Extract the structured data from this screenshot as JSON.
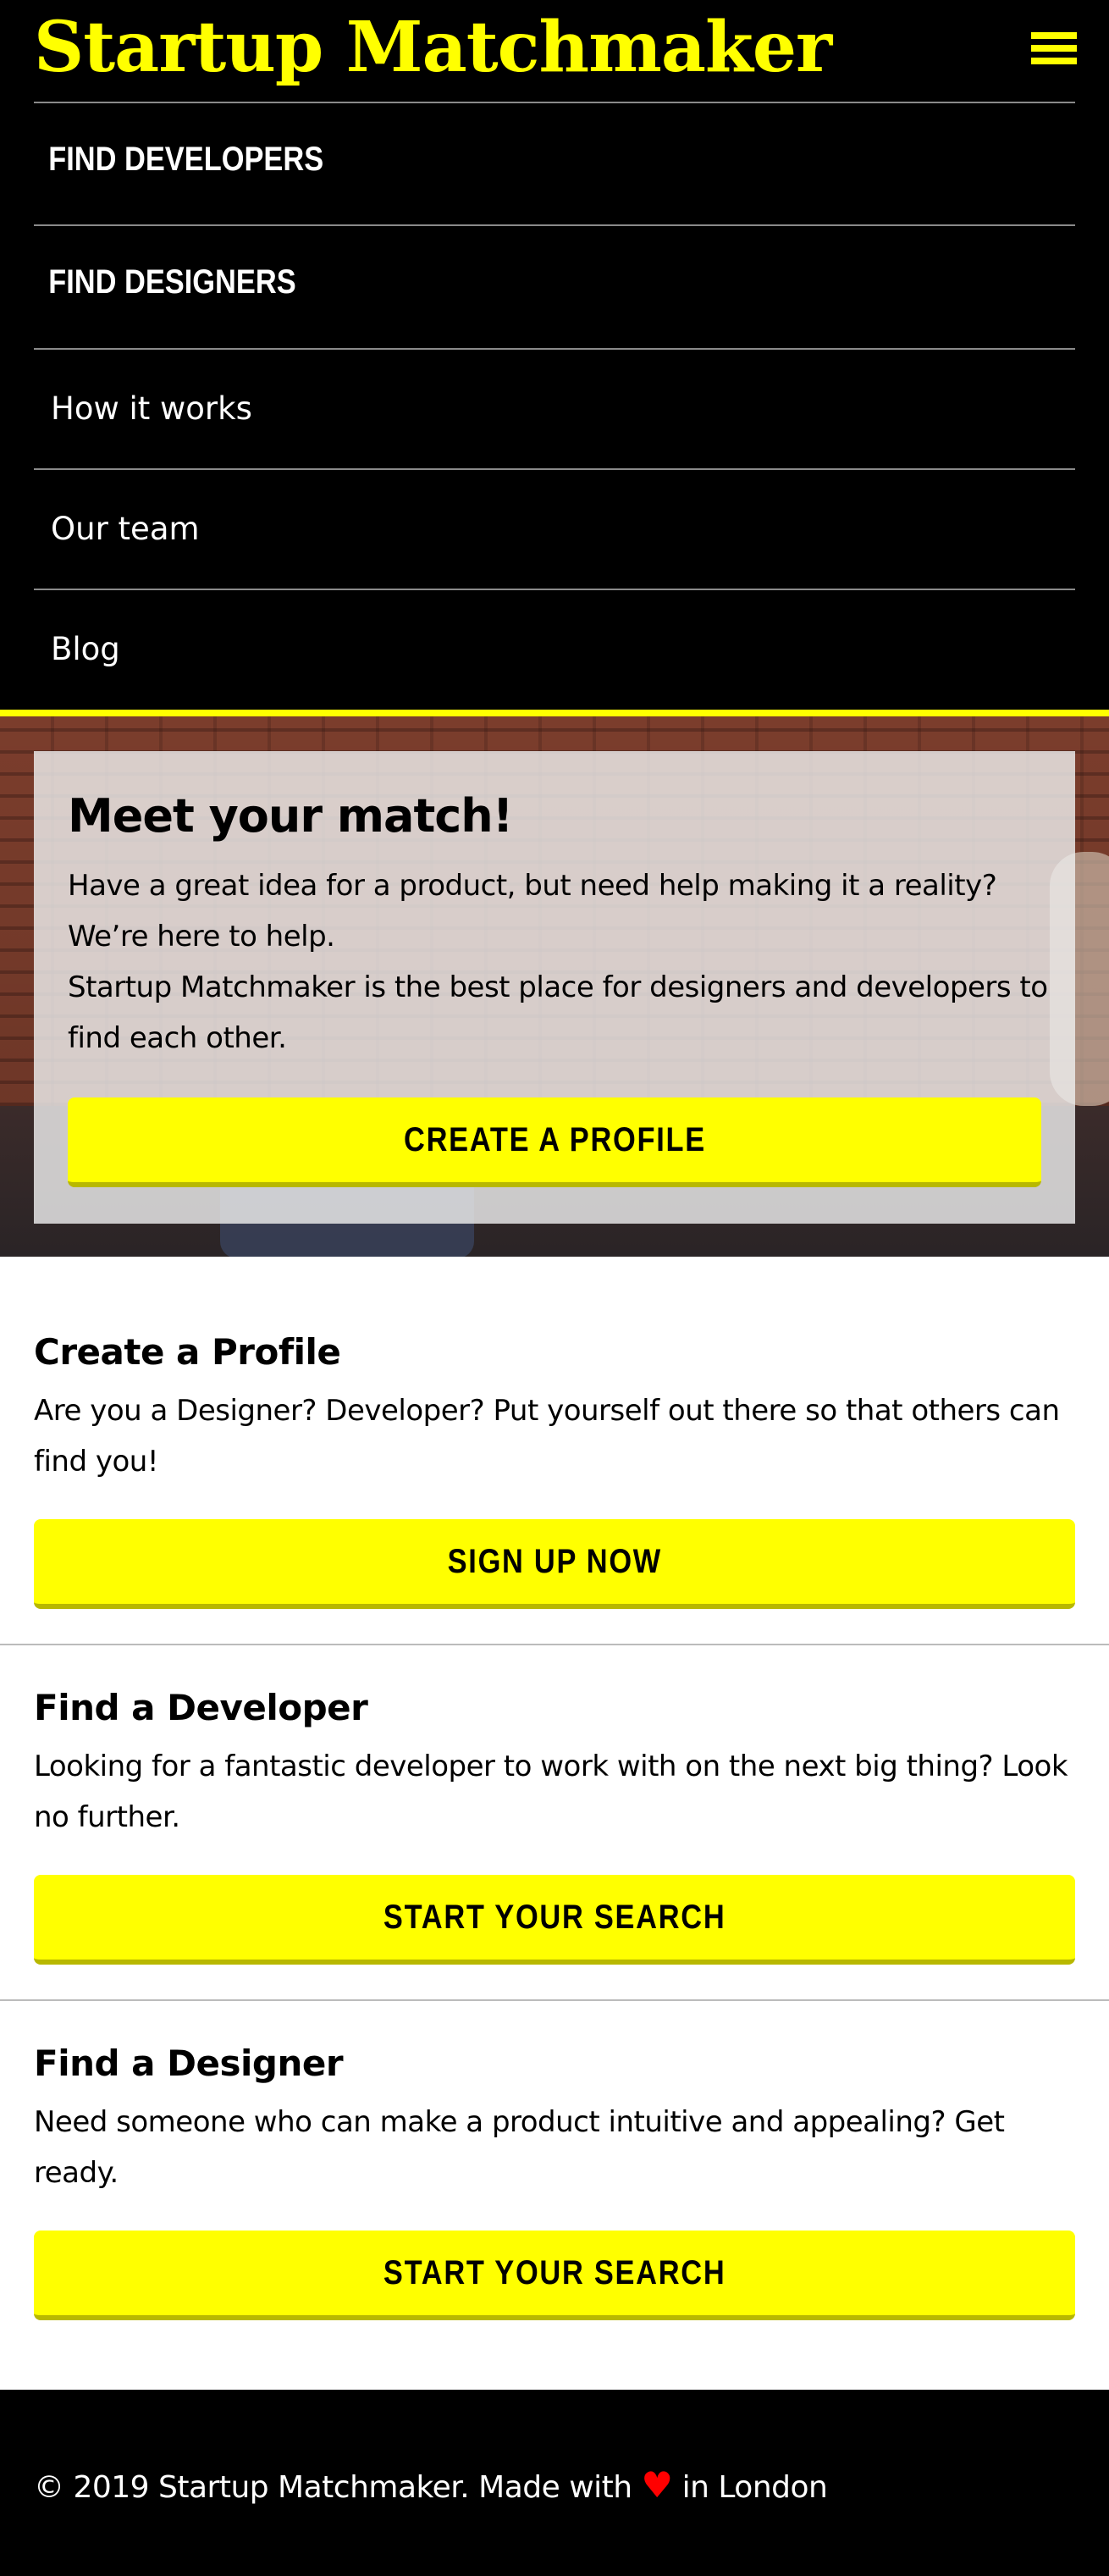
{
  "brand": "Startup Matchmaker",
  "nav": {
    "find_developers": "FIND DEVELOPERS",
    "find_designers": "FIND DESIGNERS",
    "how_it_works": "How it works",
    "our_team": "Our team",
    "blog": "Blog"
  },
  "hero": {
    "title": "Meet your match!",
    "line1": "Have a great idea for a product, but need help making it a reality?",
    "line2": "We’re here to help.",
    "line3": "Startup Matchmaker is the best place for designers and developers to",
    "line4": "find each other.",
    "cta": "CREATE A PROFILE"
  },
  "sections": [
    {
      "title": "Create a Profile",
      "line1": "Are you a Designer? Developer? Put yourself out there so that others can",
      "line2": "find you!",
      "button": "SIGN UP NOW"
    },
    {
      "title": "Find a Developer",
      "line1": "Looking for a fantastic developer to work with on the next big thing? Look",
      "line2": "no further.",
      "button": "START YOUR SEARCH"
    },
    {
      "title": "Find a Designer",
      "line1": "Need someone who can make a product intuitive and appealing? Get",
      "line2": "ready.",
      "button": "START YOUR SEARCH"
    }
  ],
  "footer": {
    "before": "© 2019 Startup Matchmaker. Made with ",
    "heart": "♥",
    "after": " in London"
  },
  "colors": {
    "accent": "#ffff00",
    "background_dark": "#000000",
    "heart": "#ff0000"
  },
  "icons": {
    "menu": "hamburger-menu-icon",
    "heart": "heart-icon"
  }
}
